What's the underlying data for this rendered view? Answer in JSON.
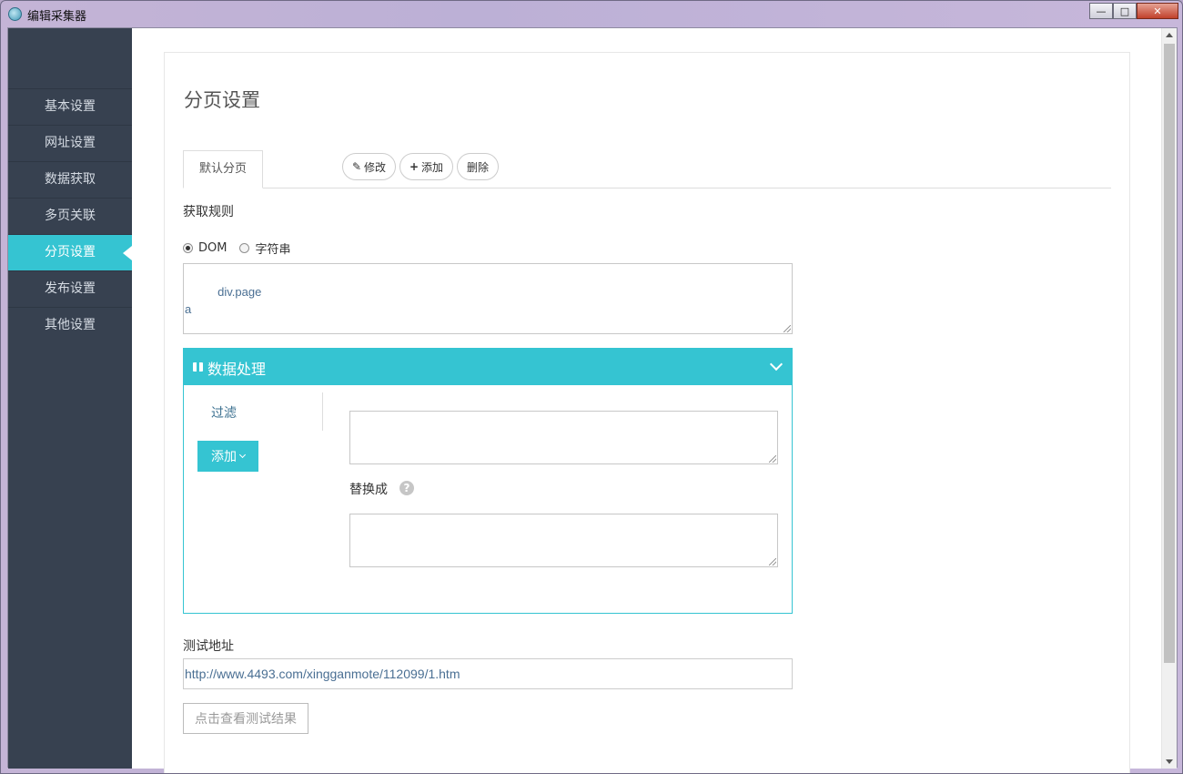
{
  "window": {
    "title": "编辑采集器",
    "minimize_icon": "minimize-icon",
    "maximize_icon": "maximize-icon",
    "close_icon": "close-icon"
  },
  "sidebar": {
    "items": [
      {
        "label": "基本设置",
        "active": false
      },
      {
        "label": "网址设置",
        "active": false
      },
      {
        "label": "数据获取",
        "active": false
      },
      {
        "label": "多页关联",
        "active": false
      },
      {
        "label": "分页设置",
        "active": true
      },
      {
        "label": "发布设置",
        "active": false
      },
      {
        "label": "其他设置",
        "active": false
      }
    ]
  },
  "main": {
    "page_title": "分页设置",
    "tabs": [
      {
        "label": "默认分页"
      }
    ],
    "actions": {
      "edit": "修改",
      "add": "添加",
      "delete": "删除"
    },
    "rule_label": "获取规则",
    "radio_dom": "DOM",
    "radio_string": "字符串",
    "rule_value": "div.page\na",
    "data_processing": {
      "title": "数据处理",
      "filter_tab": "过滤",
      "add_button": "添加",
      "replace_label": "替换成",
      "help_icon": "?"
    },
    "test_url_label": "测试地址",
    "test_url_value": "http://www.4493.com/xingganmote/112099/1.htm",
    "view_result_button": "点击查看测试结果"
  },
  "colors": {
    "sidebar_bg": "#374150",
    "accent": "#35c4d2"
  }
}
